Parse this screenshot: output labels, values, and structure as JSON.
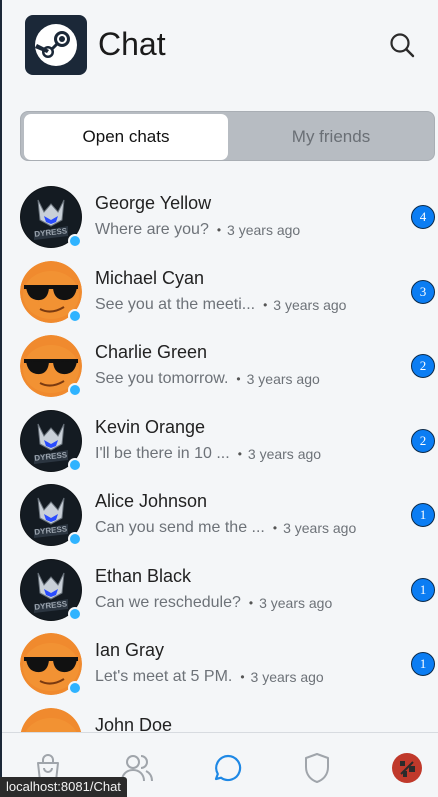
{
  "header": {
    "title": "Chat",
    "logo_icon": "steam-logo-icon",
    "search_icon": "search-icon"
  },
  "tabs": [
    {
      "label": "Open chats",
      "active": true
    },
    {
      "label": "My friends",
      "active": false
    }
  ],
  "chats": [
    {
      "name": "George Yellow",
      "preview": "Where are you?",
      "time": "3 years ago",
      "unread": "4",
      "avatar": "dark"
    },
    {
      "name": "Michael Cyan",
      "preview": "See you at the meeti...",
      "time": "3 years ago",
      "unread": "3",
      "avatar": "orange"
    },
    {
      "name": "Charlie Green",
      "preview": "See you tomorrow.",
      "time": "3 years ago",
      "unread": "2",
      "avatar": "orange"
    },
    {
      "name": "Kevin Orange",
      "preview": "I'll be there in 10 ...",
      "time": "3 years ago",
      "unread": "2",
      "avatar": "dark"
    },
    {
      "name": "Alice Johnson",
      "preview": "Can you send me the ...",
      "time": "3 years ago",
      "unread": "1",
      "avatar": "dark"
    },
    {
      "name": "Ethan Black",
      "preview": "Can we reschedule?",
      "time": "3 years ago",
      "unread": "1",
      "avatar": "dark"
    },
    {
      "name": "Ian Gray",
      "preview": "Let's meet at 5 PM.",
      "time": "3 years ago",
      "unread": "1",
      "avatar": "orange"
    },
    {
      "name": "John Doe",
      "preview": "",
      "time": "",
      "unread": "",
      "avatar": "orange"
    }
  ],
  "nav": [
    {
      "name": "shop-bag-icon",
      "active": false
    },
    {
      "name": "friends-icon",
      "active": false
    },
    {
      "name": "chat-bubble-icon",
      "active": true
    },
    {
      "name": "shield-icon",
      "active": false
    },
    {
      "name": "profile-avatar-icon",
      "active": false
    }
  ],
  "status_bar": {
    "url": "localhost:8081/Chat"
  },
  "colors": {
    "accent": "#0b7df3",
    "online": "#2fb3ff",
    "dark": "#1b2838"
  }
}
